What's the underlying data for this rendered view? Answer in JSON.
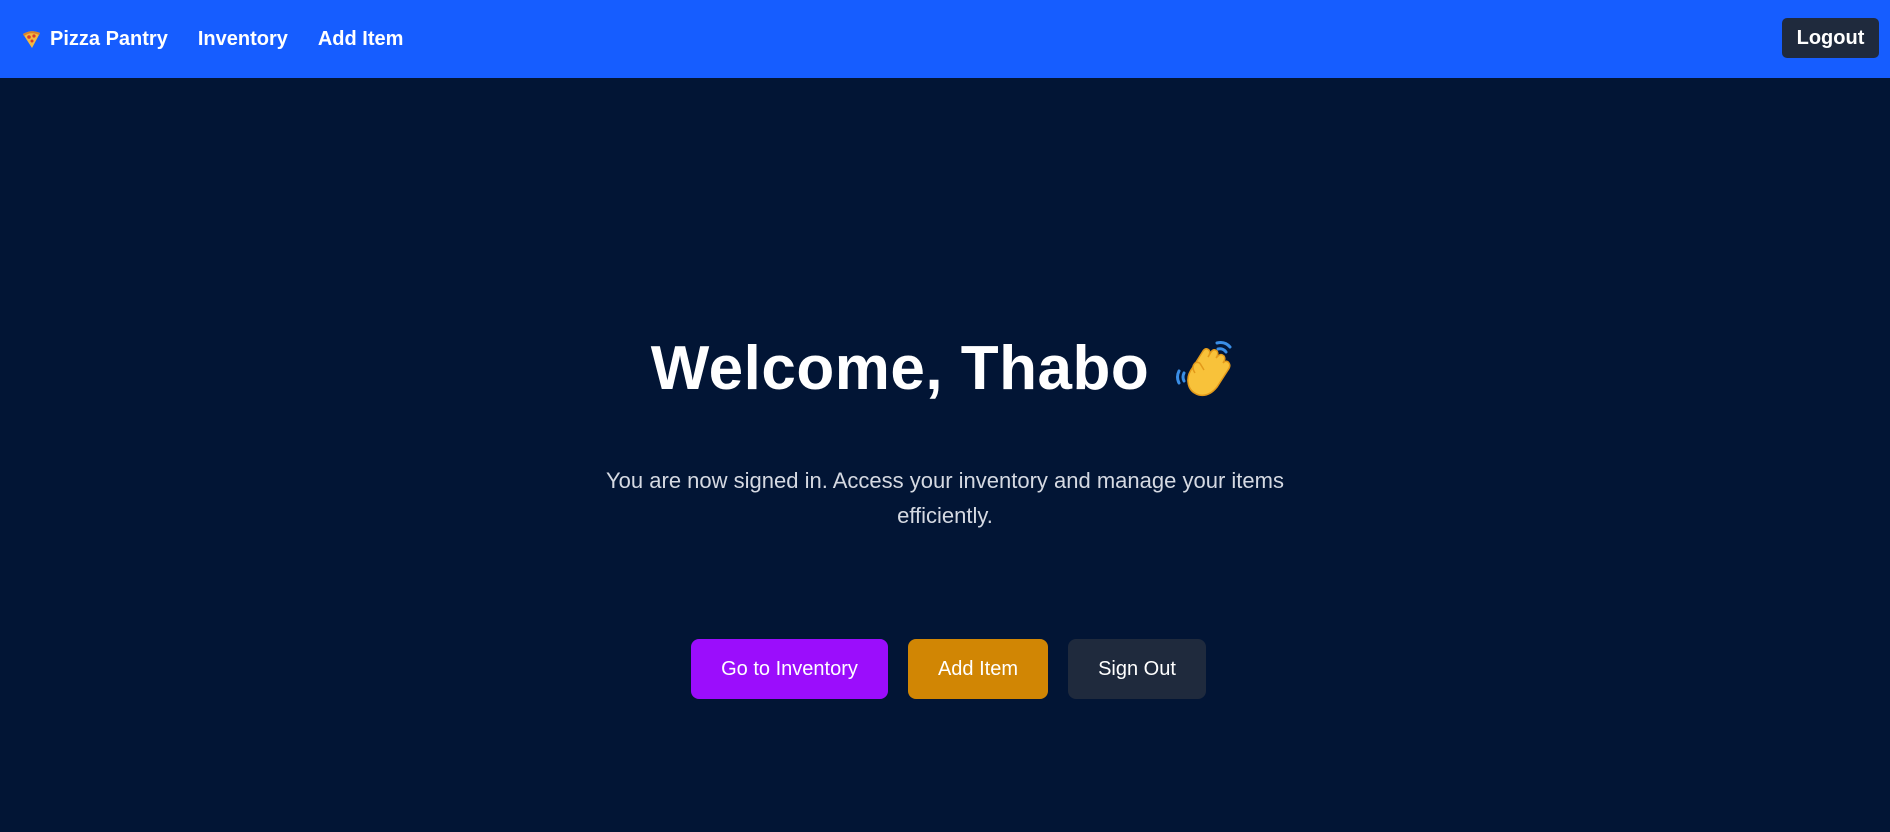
{
  "navbar": {
    "brand_icon": "pizza-slice-icon",
    "brand_label": "Pizza Pantry",
    "links": [
      {
        "label": "Inventory"
      },
      {
        "label": "Add Item"
      }
    ],
    "logout_label": "Logout",
    "background_color": "#165dff"
  },
  "main": {
    "background_color": "#021535",
    "welcome_title": "Welcome, Thabo",
    "welcome_icon": "waving-hand-icon",
    "subtitle": "You are now signed in. Access your inventory and manage your items efficiently.",
    "actions": {
      "inventory_label": "Go to Inventory",
      "inventory_color": "#9b0dfc",
      "add_label": "Add Item",
      "add_color": "#d18604",
      "signout_label": "Sign Out",
      "signout_color": "#1f2a3d"
    }
  }
}
